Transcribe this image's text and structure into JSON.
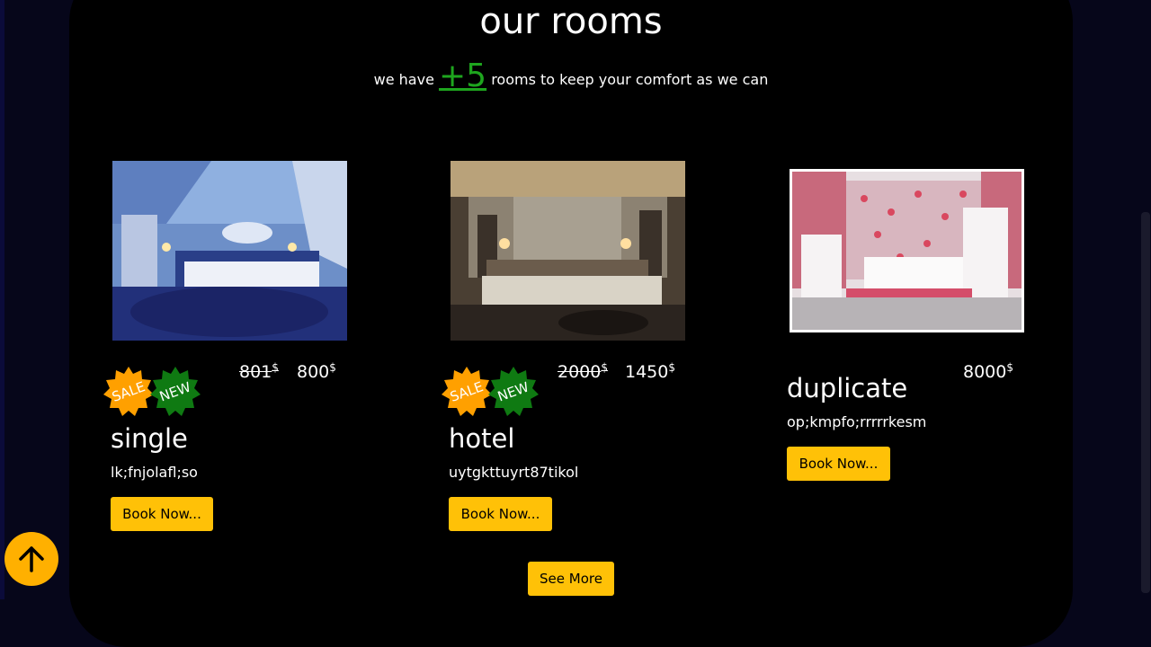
{
  "section": {
    "title": "our rooms",
    "subtitle_prefix": "we have",
    "room_count": "+5",
    "subtitle_suffix": "rooms to keep your comfort as we can"
  },
  "badges": {
    "sale": "SALE",
    "new": "NEW"
  },
  "currency_symbol": "$",
  "rooms": [
    {
      "name": "single",
      "description": "lk;fnjolafl;so",
      "old_price": "801",
      "price": "800",
      "book_label": "Book Now..."
    },
    {
      "name": "hotel",
      "description": "uytgkttuyrt87tikol",
      "old_price": "2000",
      "price": "1450",
      "book_label": "Book Now..."
    },
    {
      "name": "duplicate",
      "description": "op;kmpfo;rrrrrkesm",
      "price": "8000",
      "book_label": "Book Now..."
    }
  ],
  "see_more_label": "See More",
  "colors": {
    "accent": "#ffc107",
    "sale": "#ffa000",
    "new": "#0f7a12",
    "count": "#1ea51e"
  },
  "icons": {
    "scroll_top": "arrow-up-icon"
  }
}
